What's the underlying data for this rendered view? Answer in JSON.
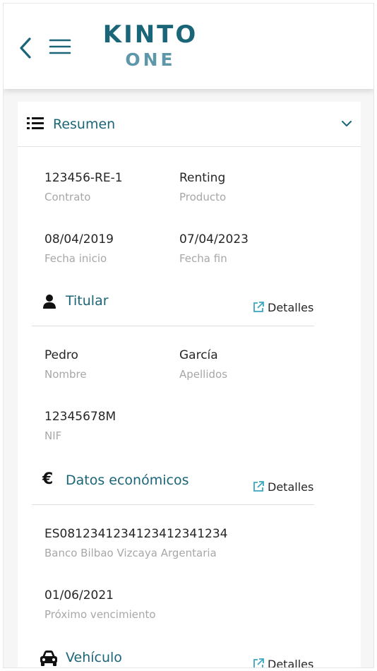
{
  "header": {
    "logo_main": "KINTO",
    "logo_sub": "ONE"
  },
  "colors": {
    "brand": "#1b6579",
    "brand_light": "#5f97aa",
    "link_icon": "#3aa6c2"
  },
  "summary": {
    "title": "Resumen",
    "contract": {
      "value": "123456-RE-1",
      "label": "Contrato"
    },
    "product": {
      "value": "Renting",
      "label": "Producto"
    },
    "start_date": {
      "value": "08/04/2019",
      "label": "Fecha inicio"
    },
    "end_date": {
      "value": "07/04/2023",
      "label": "Fecha fin"
    }
  },
  "holder": {
    "title": "Titular",
    "details_label": "Detalles",
    "name": {
      "value": "Pedro",
      "label": "Nombre"
    },
    "surname": {
      "value": "García",
      "label": "Apellidos"
    },
    "nif": {
      "value": "12345678M",
      "label": "NIF"
    }
  },
  "economic": {
    "title": "Datos económicos",
    "icon_glyph": "€",
    "details_label": "Detalles",
    "iban": {
      "value": "ES0812341234123412341234",
      "label": "Banco Bilbao Vizcaya Argentaria"
    },
    "next_due": {
      "value": "01/06/2021",
      "label": "Próximo vencimiento"
    }
  },
  "vehicle": {
    "title": "Vehículo",
    "details_label": "Detalles"
  }
}
